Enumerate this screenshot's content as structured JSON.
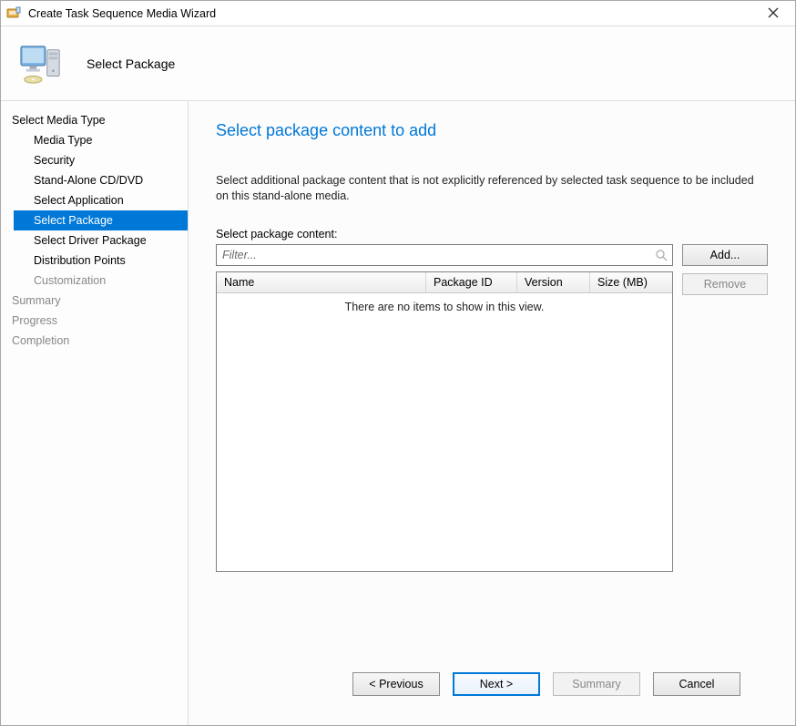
{
  "window": {
    "title": "Create Task Sequence Media Wizard"
  },
  "header": {
    "title": "Select Package"
  },
  "sidebar": {
    "group": "Select Media Type",
    "items": [
      {
        "label": "Media Type"
      },
      {
        "label": "Security"
      },
      {
        "label": "Stand-Alone CD/DVD"
      },
      {
        "label": "Select Application"
      },
      {
        "label": "Select Package",
        "selected": true
      },
      {
        "label": "Select Driver Package"
      },
      {
        "label": "Distribution Points"
      },
      {
        "label": "Customization",
        "disabled": true
      }
    ],
    "footerItems": [
      {
        "label": "Summary",
        "disabled": true
      },
      {
        "label": "Progress",
        "disabled": true
      },
      {
        "label": "Completion",
        "disabled": true
      }
    ]
  },
  "page": {
    "heading": "Select package content to add",
    "instructions": "Select additional package content that is not explicitly referenced by selected task sequence to be included on this stand-alone media.",
    "contentLabel": "Select package content:",
    "filterPlaceholder": "Filter...",
    "addLabel": "Add...",
    "removeLabel": "Remove",
    "emptyMessage": "There are no items to show in this view.",
    "columns": {
      "name": "Name",
      "packageId": "Package ID",
      "version": "Version",
      "size": "Size (MB)"
    }
  },
  "footer": {
    "previous": "< Previous",
    "next": "Next >",
    "summary": "Summary",
    "cancel": "Cancel"
  }
}
